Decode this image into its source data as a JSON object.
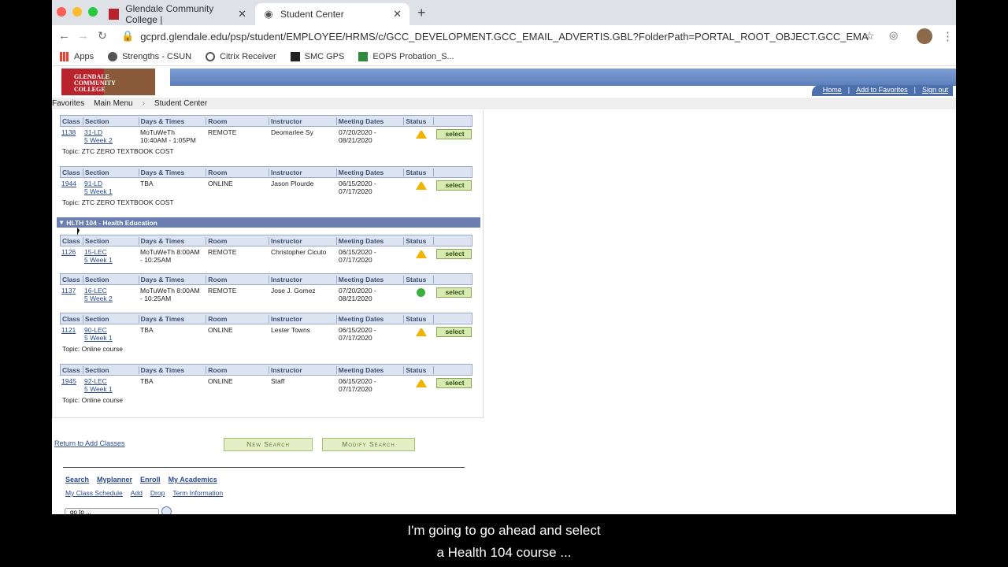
{
  "browser": {
    "tabs": [
      {
        "title": "Glendale Community College |",
        "active": false
      },
      {
        "title": "Student Center",
        "active": true
      }
    ],
    "url": "gcprd.glendale.edu/psp/student/EMPLOYEE/HRMS/c/GCC_DEVELOPMENT.GCC_EMAIL_ADVERTIS.GBL?FolderPath=PORTAL_ROOT_OBJECT.GCC_EMAIL_ADVERTIS_...",
    "bookmarks": [
      "Apps",
      "Strengths - CSUN",
      "Citrix Receiver",
      "SMC GPS",
      "EOPS Probation_S..."
    ]
  },
  "header": {
    "logo_text": "GLENDALE COMMUNITY COLLEGE",
    "links": [
      "Home",
      "Add to Favorites",
      "Sign out"
    ]
  },
  "breadcrumb": [
    "Favorites",
    "Main Menu",
    "Student Center"
  ],
  "columns": [
    "Class",
    "Section",
    "Days & Times",
    "Room",
    "Instructor",
    "Meeting Dates",
    "Status"
  ],
  "course": "HLTH 104 - Health Education",
  "select_label": "select",
  "topic_prefix": "Topic:",
  "rows": [
    {
      "class": "1138",
      "section": "31-LD",
      "session": "5 Week 2",
      "days": "MoTuWeTh",
      "times": "10:40AM - 1:05PM",
      "room": "REMOTE",
      "instructor": "Deomarlee Sy",
      "start": "07/20/2020 -",
      "end": "08/21/2020",
      "status": "warning",
      "topic": "ZTC ZERO TEXTBOOK COST"
    },
    {
      "class": "1944",
      "section": "91-LD",
      "session": "5 Week 1",
      "days": "TBA",
      "times": "",
      "room": "ONLINE",
      "instructor": "Jason Plourde",
      "start": "06/15/2020 -",
      "end": "07/17/2020",
      "status": "warning",
      "topic": "ZTC ZERO TEXTBOOK COST"
    },
    {
      "class": "1126",
      "section": "15-LEC",
      "session": "5 Week 1",
      "days": "MoTuWeTh 8:00AM",
      "times": "- 10:25AM",
      "room": "REMOTE",
      "instructor": "Christopher Cicuto",
      "start": "06/15/2020 -",
      "end": "07/17/2020",
      "status": "warning",
      "topic": ""
    },
    {
      "class": "1137",
      "section": "16-LEC",
      "session": "5 Week 2",
      "days": "MoTuWeTh 8:00AM",
      "times": "- 10:25AM",
      "room": "REMOTE",
      "instructor": "Jose J. Gomez",
      "start": "07/20/2020 -",
      "end": "08/21/2020",
      "status": "open",
      "topic": ""
    },
    {
      "class": "1121",
      "section": "90-LEC",
      "session": "5 Week 1",
      "days": "TBA",
      "times": "",
      "room": "ONLINE",
      "instructor": "Lester Towns",
      "start": "06/15/2020 -",
      "end": "07/17/2020",
      "status": "warning",
      "topic": "Online course"
    },
    {
      "class": "1945",
      "section": "92-LEC",
      "session": "5 Week 1",
      "days": "TBA",
      "times": "",
      "room": "ONLINE",
      "instructor": "Staff",
      "start": "06/15/2020 -",
      "end": "07/17/2020",
      "status": "warning",
      "topic": "Online course"
    }
  ],
  "actions": {
    "return": "Return to Add Classes",
    "new_search": "New Search",
    "modify_search": "Modify Search"
  },
  "footer_nav": [
    "Search",
    "Myplanner",
    "Enroll",
    "My Academics"
  ],
  "footer_sub": [
    "My Class Schedule",
    "Add",
    "Drop",
    "Term Information"
  ],
  "goto": "go to ...",
  "subtitle": [
    "I'm going to go ahead and select",
    "a Health 104 course ..."
  ],
  "colors": {
    "course_bar": "#6b7fb2",
    "grid_header": "#dbe4f0",
    "select_btn": "#d7eab0",
    "warning": "#f0b400",
    "open": "#3bb03b"
  }
}
